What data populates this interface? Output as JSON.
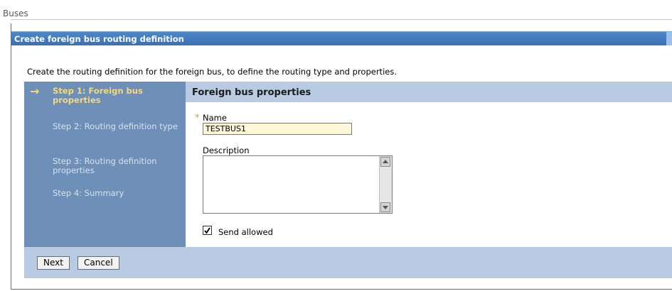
{
  "breadcrumb": "Buses",
  "panel_title": "Create foreign bus routing definition",
  "intro": "Create the routing definition for the foreign bus, to define the routing type and properties.",
  "steps": [
    {
      "label": "Step 1: Foreign bus properties",
      "current": true
    },
    {
      "label": "Step 2: Routing definition type",
      "current": false
    },
    {
      "label": "Step 3: Routing definition properties",
      "current": false
    },
    {
      "label": "Step 4: Summary",
      "current": false
    }
  ],
  "section_title": "Foreign bus properties",
  "required_marker": "*",
  "form": {
    "name_label": "Name",
    "name_value": "TESTBUS1",
    "description_label": "Description",
    "description_value": "",
    "send_allowed_label": "Send allowed",
    "send_allowed": true
  },
  "buttons": {
    "next": "Next",
    "cancel": "Cancel"
  },
  "icons": {
    "current_step": "arrow-right-icon",
    "scroll_up": "scroll-up-icon",
    "scroll_down": "scroll-down-icon"
  },
  "colors": {
    "title_bar": "#3a70b4",
    "steps_panel": "#6e8fb8",
    "section_header": "#b9cbe3",
    "current_step": "#f5d97b",
    "name_field": "#fff7d8"
  }
}
